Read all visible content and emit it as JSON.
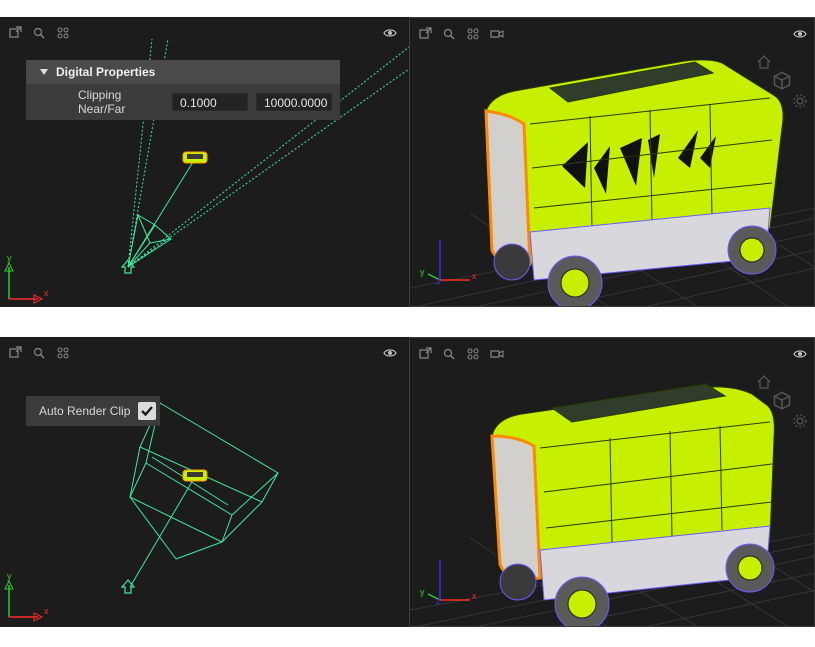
{
  "top": {
    "properties_panel": {
      "title": "Digital Properties",
      "clipping_label": "Clipping Near/Far",
      "near_value": "0.1000",
      "far_value": "10000.0000"
    }
  },
  "bottom": {
    "auto_render_clip": {
      "label": "Auto Render Clip",
      "checked": true
    }
  },
  "axes": {
    "x": "x",
    "y": "y",
    "z": "z"
  },
  "toolbar_icons": [
    "maximize-icon",
    "zoom-icon",
    "grid-view-icon",
    "camera-icon",
    "eye-icon"
  ],
  "colors": {
    "viewport_bg": "#1c1c1c",
    "panel_bg": "#3b3b3b",
    "wireframe": "#3fe8a0",
    "body_highlight": "#c6f000",
    "grid_axis_x": "#ff2a2a",
    "grid_axis_y": "#28d028",
    "grid_axis_z": "#3030ff"
  }
}
